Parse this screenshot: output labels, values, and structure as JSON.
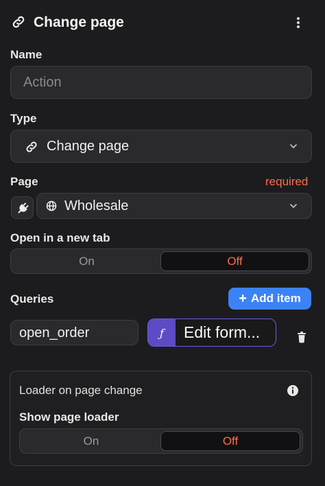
{
  "header": {
    "title": "Change page",
    "icon": "link-icon",
    "menu_icon": "more-vertical-icon"
  },
  "name": {
    "label": "Name",
    "placeholder": "Action",
    "value": ""
  },
  "type": {
    "label": "Type",
    "value": "Change page",
    "icon": "link-icon"
  },
  "page": {
    "label": "Page",
    "required_text": "required",
    "value": "Wholesale",
    "plug_icon": "plug-icon",
    "globe_icon": "globe-icon"
  },
  "new_tab": {
    "label": "Open in a new tab",
    "options": [
      "On",
      "Off"
    ],
    "selected": "Off"
  },
  "queries": {
    "label": "Queries",
    "add_button": "Add item",
    "items": [
      {
        "key": "open_order",
        "function_symbol": "ƒ",
        "value": "Edit form..."
      }
    ]
  },
  "loader": {
    "title": "Loader on page change",
    "show_label": "Show page loader",
    "options": [
      "On",
      "Off"
    ],
    "selected": "Off"
  },
  "colors": {
    "accent": "#ff6b4a",
    "primary": "#3b82f6",
    "function": "#5b4bc4"
  }
}
